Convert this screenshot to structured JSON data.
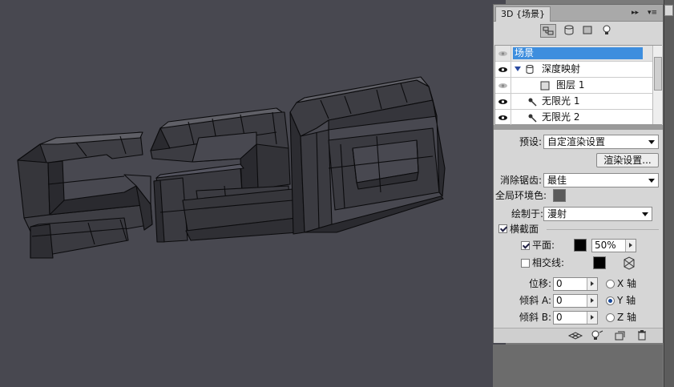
{
  "panel": {
    "tab_title": "3D {场景}",
    "tab_menu_glyph": "▸▸",
    "menu_glyph": "▾≡"
  },
  "layers": [
    {
      "name": "场景",
      "selected": true
    },
    {
      "name": "深度映射"
    },
    {
      "name": "图层 1"
    },
    {
      "name": "无限光 1"
    },
    {
      "name": "无限光 2"
    }
  ],
  "settings": {
    "preset_label": "预设:",
    "preset_value": "自定渲染设置",
    "render_settings_button": "渲染设置...",
    "antialias_label": "消除锯齿:",
    "antialias_value": "最佳",
    "global_ambient_label": "全局环境色:",
    "global_ambient_color": "#5a5a5a",
    "paint_on_label": "绘制于:",
    "paint_on_value": "漫射",
    "cross_section_label": "横截面",
    "cross_section_checked": true,
    "plane_label": "平面:",
    "plane_checked": true,
    "plane_color": "#000000",
    "plane_opacity": "50%",
    "intersection_label": "相交线:",
    "intersection_checked": false,
    "intersection_color": "#000000",
    "offset_label": "位移:",
    "offset_value": "0",
    "tilt_a_label": "倾斜 A:",
    "tilt_a_value": "0",
    "tilt_b_label": "倾斜 B:",
    "tilt_b_value": "0",
    "x_axis_label": "X 轴",
    "y_axis_label": "Y 轴",
    "z_axis_label": "Z 轴",
    "selected_axis": "Y"
  },
  "canvas_text": "526",
  "colors": {
    "canvas_bg": "#484850",
    "panel_bg": "#d6d6d6",
    "selection": "#3e8ede"
  }
}
